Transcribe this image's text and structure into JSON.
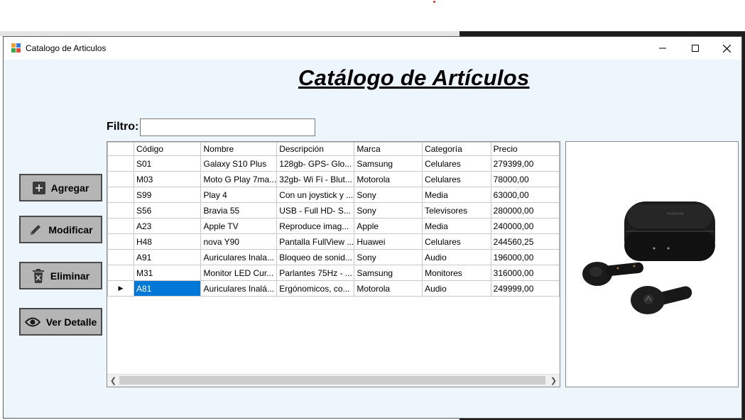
{
  "window": {
    "title": "Catalogo de Articulos",
    "heading": "Catálogo de Artículos"
  },
  "filter": {
    "label": "Filtro:",
    "value": "",
    "placeholder": ""
  },
  "buttons": {
    "add": {
      "label": "Agregar",
      "icon": "plus-icon"
    },
    "modify": {
      "label": "Modificar",
      "icon": "pencil-icon"
    },
    "delete": {
      "label": "Eliminar",
      "icon": "trash-icon"
    },
    "detail": {
      "label": "Ver Detalle",
      "icon": "eye-icon"
    }
  },
  "table": {
    "columns": [
      "Código",
      "Nombre",
      "Descripción",
      "Marca",
      "Categoría",
      "Precio"
    ],
    "rows": [
      [
        "S01",
        "Galaxy S10 Plus",
        "128gb- GPS- Glo...",
        "Samsung",
        "Celulares",
        "279399,00"
      ],
      [
        "M03",
        "Moto G Play 7ma...",
        "32gb- Wi Fi - Blut...",
        "Motorola",
        "Celulares",
        "78000,00"
      ],
      [
        "S99",
        "Play 4",
        "Con un joystick y ...",
        "Sony",
        "Media",
        "63000,00"
      ],
      [
        "S56",
        "Bravia 55",
        "USB - Full HD- S...",
        "Sony",
        "Televisores",
        "280000,00"
      ],
      [
        "A23",
        "Apple TV",
        "Reproduce imag...",
        "Apple",
        "Media",
        "240000,00"
      ],
      [
        "H48",
        "nova Y90",
        "Pantalla FullView ...",
        "Huawei",
        "Celulares",
        "244560,25"
      ],
      [
        "A91",
        "Auriculares Inala...",
        "Bloqueo de sonid...",
        "Sony",
        "Audio",
        "196000,00"
      ],
      [
        "M31",
        "Monitor LED Cur...",
        "Parlantes 75Hz - ...",
        "Samsung",
        "Monitores",
        "316000,00"
      ],
      [
        "A81",
        "Auriculares Inalá...",
        "Ergónomicos, co...",
        "Motorola",
        "Audio",
        "249999,00"
      ]
    ],
    "selected_row": 8,
    "current_row_marker": "▶"
  },
  "colors": {
    "selection": "#0078d7",
    "button_bg": "#b5b5b5",
    "window_bg": "#eef6fd"
  }
}
